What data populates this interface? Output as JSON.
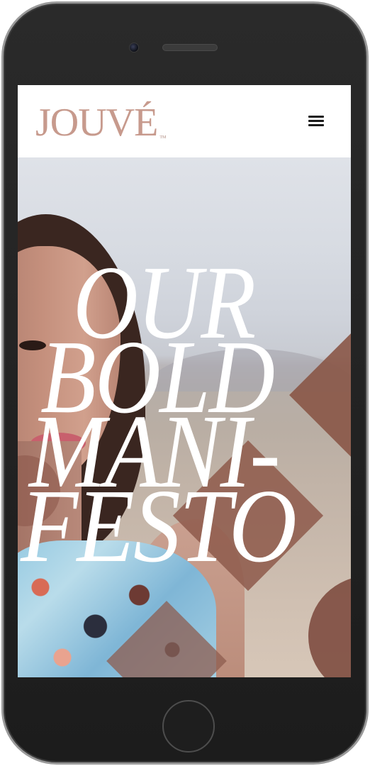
{
  "brand": {
    "logo_text": "JOUVÉ",
    "logo_mark": "TM",
    "logo_color": "#c79a8d"
  },
  "header": {
    "menu_icon": "hamburger-menu-icon"
  },
  "hero": {
    "headline_lines": [
      "OUR",
      "BOLD",
      "MANI-",
      "FESTO"
    ],
    "accent_color": "#8f5c4d"
  },
  "device": {
    "frame_color": "#1c1c1c"
  }
}
